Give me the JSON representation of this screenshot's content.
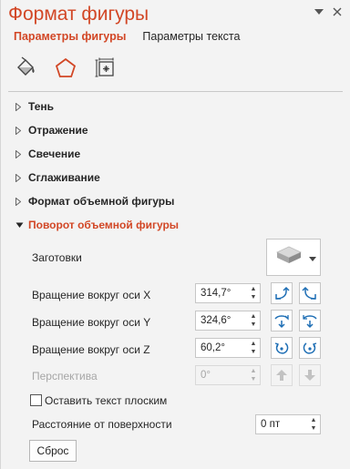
{
  "pane": {
    "title": "Формат фигуры",
    "tabs": [
      {
        "label": "Параметры фигуры",
        "active": true
      },
      {
        "label": "Параметры текста",
        "active": false
      }
    ],
    "icons": [
      "fill-line-icon",
      "effects-pentagon-icon",
      "size-properties-icon"
    ],
    "accent": "#d24726"
  },
  "sections": [
    {
      "label": "Тень",
      "open": false
    },
    {
      "label": "Отражение",
      "open": false
    },
    {
      "label": "Свечение",
      "open": false
    },
    {
      "label": "Сглаживание",
      "open": false
    },
    {
      "label": "Формат объемной фигуры",
      "open": false
    },
    {
      "label": "Поворот объемной фигуры",
      "open": true
    }
  ],
  "rotation": {
    "presets_label": "Заготовки",
    "x": {
      "label": "Вращение вокруг оси X",
      "value": "314,7°"
    },
    "y": {
      "label": "Вращение вокруг оси Y",
      "value": "324,6°"
    },
    "z": {
      "label": "Вращение вокруг оси Z",
      "value": "60,2°"
    },
    "perspective": {
      "label": "Перспектива",
      "value": "0°",
      "disabled": true
    },
    "keep_flat_label": "Оставить текст плоским",
    "keep_flat_checked": false,
    "distance": {
      "label": "Расстояние от поверхности",
      "value": "0 пт"
    },
    "reset_label": "Сброс"
  }
}
